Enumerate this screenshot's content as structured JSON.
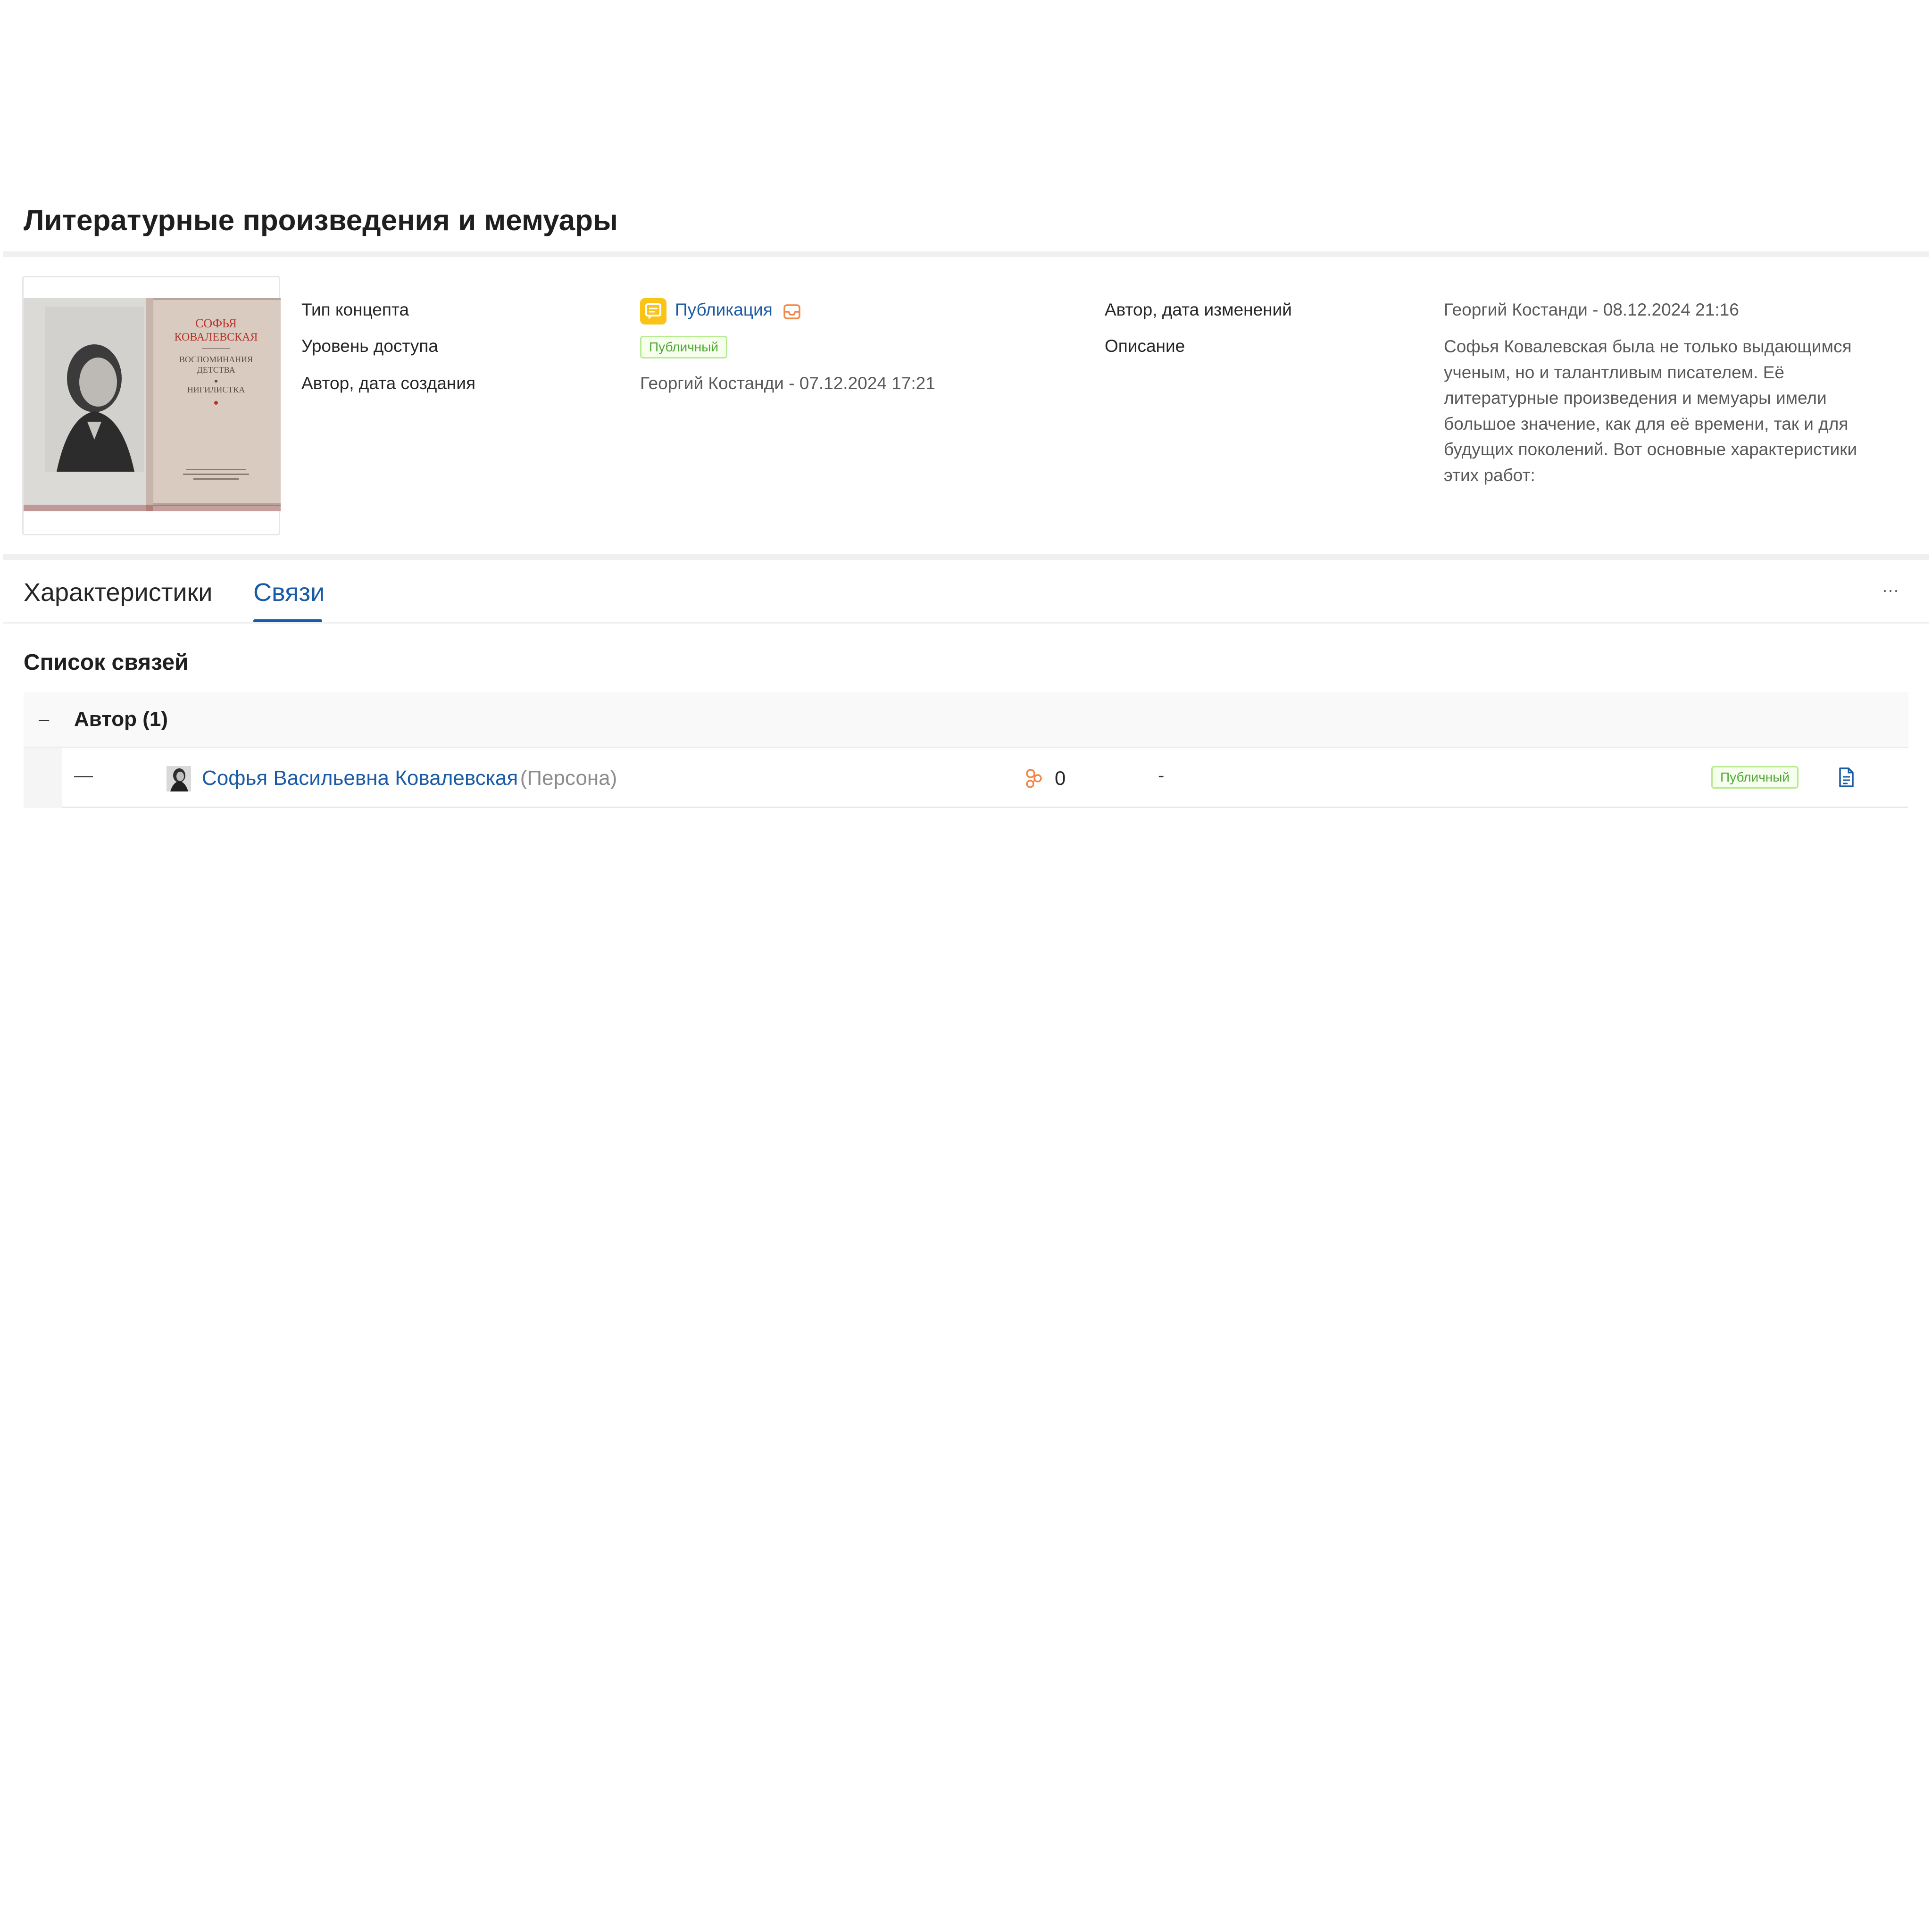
{
  "page": {
    "title": "Литературные произведения и мемуары"
  },
  "cover": {
    "lines": [
      "СОФЬЯ",
      "КОВАЛЕВСКАЯ",
      "ВОСПОМИНАНИЯ",
      "ДЕТСТВА",
      "НИГИЛИСТКА"
    ]
  },
  "properties": {
    "concept_type_label": "Тип концепта",
    "concept_type_value": "Публикация",
    "access_level_label": "Уровень доступа",
    "access_level_value": "Публичный",
    "created_label": "Автор, дата создания",
    "created_value": "Георгий  Костанди - 07.12.2024 17:21",
    "modified_label": "Автор, дата изменений",
    "modified_value": "Георгий  Костанди - 08.12.2024 21:16",
    "description_label": "Описание",
    "description_lines": [
      "Софья Ковалевская была не только выдающимся",
      "ученым, но и талантливым писателем. Её",
      "литературные произведения и мемуары имели",
      "большое значение, как для её времени, так и для",
      "будущих поколений. Вот основные характеристики",
      "этих работ:"
    ]
  },
  "tabs": [
    {
      "label": "Характеристики",
      "active": false
    },
    {
      "label": "Связи",
      "active": true
    }
  ],
  "more_label": "···",
  "links": {
    "title": "Список связей",
    "group": {
      "toggle": "–",
      "label": "Автор (1)"
    },
    "item": {
      "dash": "—",
      "name": "Софья Васильевна Ковалевская",
      "type": "(Персона)",
      "count": "0",
      "extra": "-",
      "access": "Публичный"
    }
  },
  "colors": {
    "accent": "#1a5ba6",
    "type_icon": "#fac315",
    "badge_text": "#52a43a",
    "badge_border": "#b7eb8f",
    "orange_icon": "#f0884a"
  },
  "icons": {
    "concept_type": "publication-icon",
    "inbox": "inbox-icon",
    "relations": "relations-icon",
    "document": "document-icon",
    "avatar": "person-avatar"
  }
}
